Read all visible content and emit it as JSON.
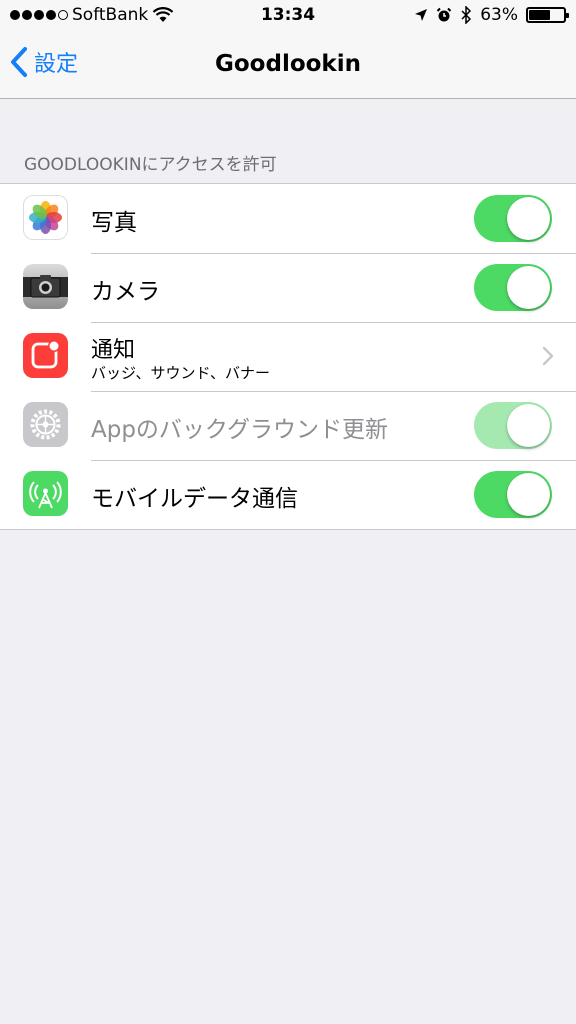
{
  "status": {
    "carrier": "SoftBank",
    "time": "13:34",
    "battery": "63%",
    "battery_level": 0.63,
    "signal_bars": 4
  },
  "nav": {
    "back_label": "設定",
    "title": "Goodlookin"
  },
  "section": {
    "header": "GOODLOOKINにアクセスを許可"
  },
  "rows": [
    {
      "label": "写真",
      "icon": "photos-icon",
      "toggle": true
    },
    {
      "label": "カメラ",
      "icon": "camera-icon",
      "toggle": true
    },
    {
      "label": "通知",
      "sub": "バッジ、サウンド、バナー",
      "icon": "notifications-icon",
      "disclosure": true
    },
    {
      "label": "Appのバックグラウンド更新",
      "icon": "settings-gear-icon",
      "toggle": true,
      "disabled": true
    },
    {
      "label": "モバイルデータ通信",
      "icon": "cellular-icon",
      "toggle": true
    }
  ],
  "colors": {
    "accent": "#157efb",
    "toggle_on": "#4cd964",
    "toggle_disabled": "#a5e9b0",
    "background": "#efeff4"
  }
}
